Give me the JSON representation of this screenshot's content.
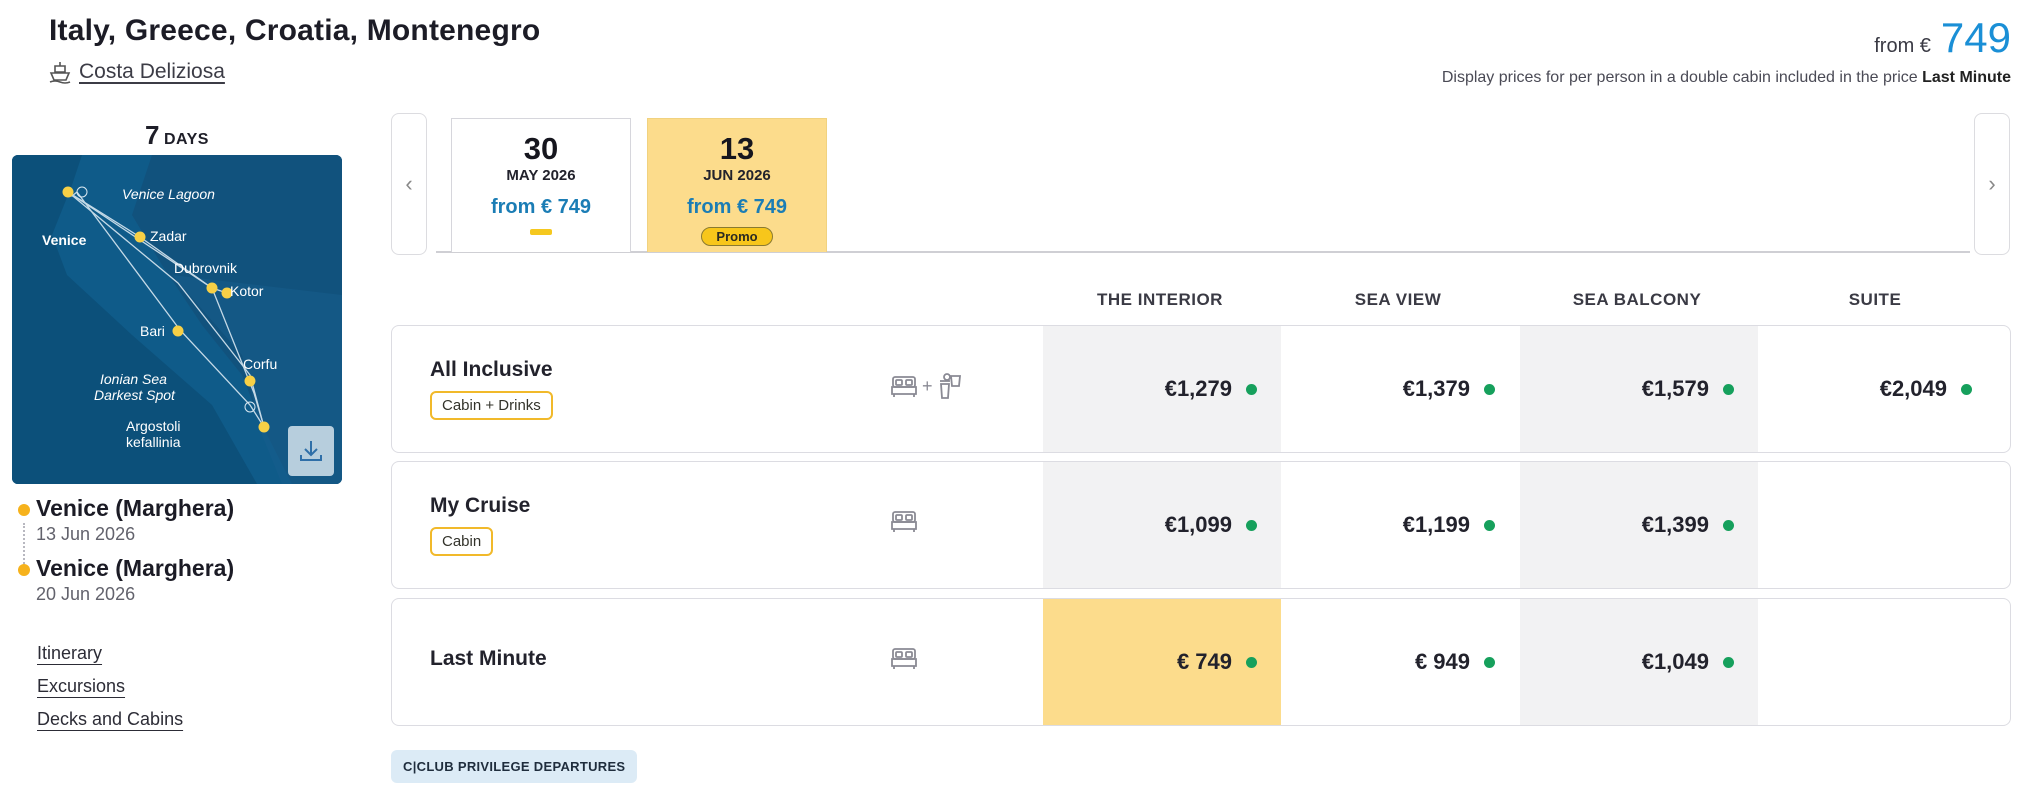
{
  "header": {
    "title": "Italy, Greece, Croatia, Montenegro",
    "ship_name": "Costa Deliziosa",
    "from_label": "from €",
    "from_price": "749",
    "price_note_prefix": "Display prices for per person in a double cabin included in the price",
    "price_note_strong": "Last Minute"
  },
  "sidebar": {
    "days_num": "7",
    "days_label": "DAYS",
    "map_places": [
      "Venice Lagoon",
      "Venice",
      "Zadar",
      "Dubrovnik",
      "Kotor",
      "Bari",
      "Corfu",
      "Ionian Sea",
      "Darkest Spot",
      "Argostoli",
      "kefallinia"
    ],
    "route": [
      {
        "name": "Venice (Marghera)",
        "date": "13 Jun 2026"
      },
      {
        "name": "Venice (Marghera)",
        "date": "20 Jun 2026"
      }
    ],
    "links": [
      "Itinerary",
      "Excursions",
      "Decks and Cabins"
    ]
  },
  "dates": [
    {
      "day": "30",
      "month": "MAY 2026",
      "from": "from € 749",
      "badge": ""
    },
    {
      "day": "13",
      "month": "JUN 2026",
      "from": "from € 749",
      "badge": "Promo"
    }
  ],
  "columns": [
    "THE INTERIOR",
    "SEA VIEW",
    "SEA BALCONY",
    "SUITE"
  ],
  "rows": [
    {
      "title": "All Inclusive",
      "badge": "Cabin + Drinks",
      "prices": [
        "€1,279",
        "€1,379",
        "€1,579",
        "€2,049"
      ]
    },
    {
      "title": "My Cruise",
      "badge": "Cabin",
      "prices": [
        "€1,099",
        "€1,199",
        "€1,399",
        ""
      ]
    },
    {
      "title": "Last Minute",
      "badge": "",
      "prices": [
        "€ 749",
        "€ 949",
        "€1,049",
        ""
      ]
    }
  ],
  "icons": {
    "plus": "+"
  },
  "footer": {
    "club_label": "C|CLUB PRIVILEGE DEPARTURES"
  },
  "colors": {
    "accent_blue": "#1a8fd6",
    "highlight_yellow": "#fcdc8c",
    "available_green": "#16a05c",
    "route_dot": "#f6b21c"
  }
}
